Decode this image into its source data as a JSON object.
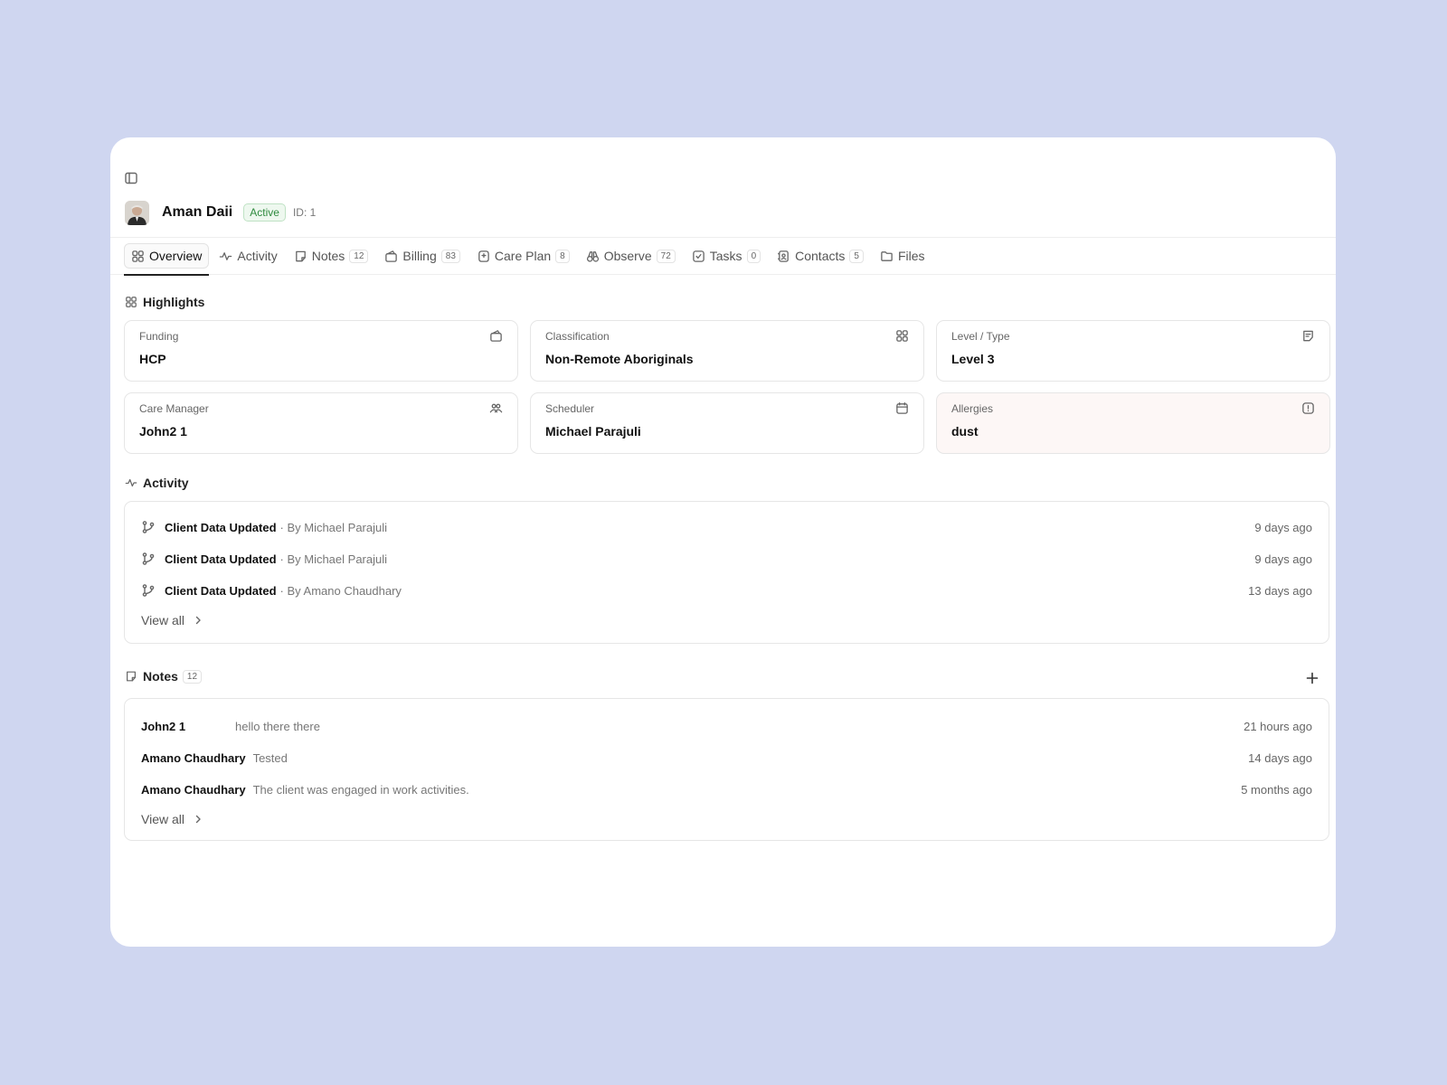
{
  "client": {
    "name": "Aman Daii",
    "status": "Active",
    "id_label": "ID: 1"
  },
  "tabs": [
    {
      "label": "Overview",
      "icon": "overview-icon",
      "count": null,
      "active": true
    },
    {
      "label": "Activity",
      "icon": "activity-icon",
      "count": null
    },
    {
      "label": "Notes",
      "icon": "notes-icon",
      "count": "12"
    },
    {
      "label": "Billing",
      "icon": "wallet-icon",
      "count": "83"
    },
    {
      "label": "Care Plan",
      "icon": "care-plan-icon",
      "count": "8"
    },
    {
      "label": "Observe",
      "icon": "binoculars-icon",
      "count": "72"
    },
    {
      "label": "Tasks",
      "icon": "check-square-icon",
      "count": "0"
    },
    {
      "label": "Contacts",
      "icon": "contact-book-icon",
      "count": "5"
    },
    {
      "label": "Files",
      "icon": "folder-icon",
      "count": null
    }
  ],
  "highlights": {
    "title": "Highlights",
    "cards": [
      {
        "label": "Funding",
        "value": "HCP",
        "icon": "wallet-icon"
      },
      {
        "label": "Classification",
        "value": "Non-Remote Aboriginals",
        "icon": "grid-icon"
      },
      {
        "label": "Level / Type",
        "value": "Level 3",
        "icon": "document-icon"
      },
      {
        "label": "Care Manager",
        "value": "John2 1",
        "icon": "users-icon"
      },
      {
        "label": "Scheduler",
        "value": "Michael Parajuli",
        "icon": "calendar-icon"
      },
      {
        "label": "Allergies",
        "value": "dust",
        "icon": "alert-icon",
        "highlight_color": "#fdf7f6"
      }
    ]
  },
  "activity": {
    "title": "Activity",
    "items": [
      {
        "title": "Client Data Updated",
        "by": "· By Michael Parajuli",
        "time": "9 days ago"
      },
      {
        "title": "Client Data Updated",
        "by": "· By Michael Parajuli",
        "time": "9 days ago"
      },
      {
        "title": "Client Data Updated",
        "by": "· By Amano Chaudhary",
        "time": "13 days ago"
      }
    ],
    "view_all": "View all"
  },
  "notes": {
    "title": "Notes",
    "count": "12",
    "items": [
      {
        "author": "John2 1",
        "text": "hello there there",
        "time": "21 hours ago"
      },
      {
        "author": "Amano Chaudhary",
        "text": "Tested",
        "time": "14 days ago"
      },
      {
        "author": "Amano Chaudhary",
        "text": "The client was engaged in work activities.",
        "time": "5 months ago"
      }
    ],
    "view_all": "View all"
  },
  "colors": {
    "background": "#cfd6f0",
    "active_badge": "#2f8a3e",
    "allergy_card": "#fdf7f6"
  }
}
